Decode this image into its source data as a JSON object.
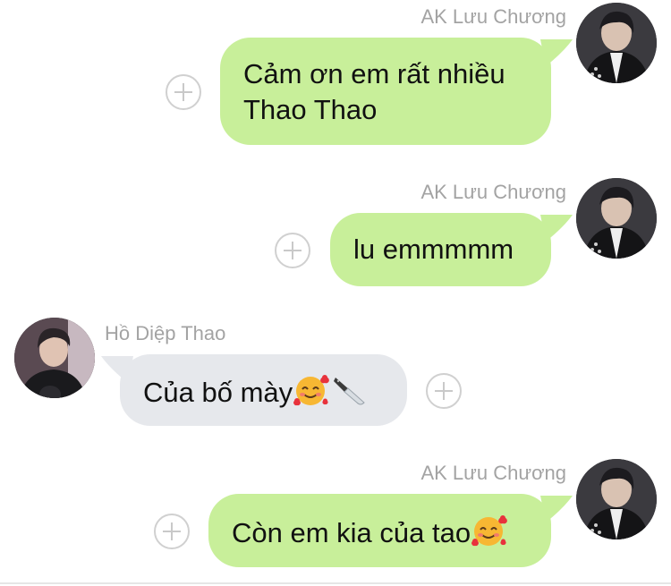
{
  "messages": [
    {
      "sender": "AK Lưu Chương",
      "lines": [
        "Cảm ơn em rất nhiều",
        "Thao Thao"
      ]
    },
    {
      "sender": "AK Lưu Chương",
      "lines": [
        "lu emmmmm"
      ]
    },
    {
      "sender": "Hồ Diệp Thao",
      "lines": [
        "Của bố mày"
      ],
      "emojis": [
        "smiling-face-with-hearts",
        "kitchen-knife"
      ]
    },
    {
      "sender": "AK Lưu Chương",
      "lines": [
        "Còn em kia của tao"
      ],
      "emojis": [
        "smiling-face-with-hearts"
      ]
    }
  ],
  "colors": {
    "outgoing_bubble": "#c8ef9a",
    "incoming_bubble": "#e6e8ec",
    "sender_name": "#a3a3a3",
    "plus_icon": "#c9c9c9"
  }
}
